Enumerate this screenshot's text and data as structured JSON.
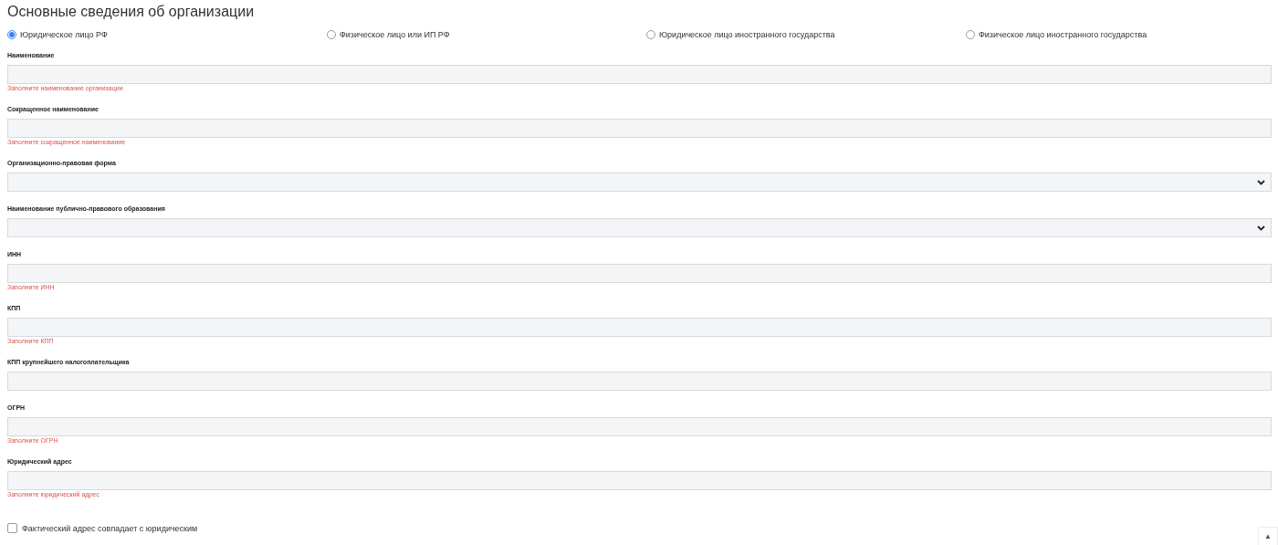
{
  "title": "Основные сведения об организации",
  "entity_types": [
    {
      "label": "Юридическое лицо РФ",
      "selected": true
    },
    {
      "label": "Физическое лицо или ИП РФ",
      "selected": false
    },
    {
      "label": "Юридическое лицо иностранного государства",
      "selected": false
    },
    {
      "label": "Физическое лицо иностранного государства",
      "selected": false
    }
  ],
  "fields": [
    {
      "kind": "text",
      "label": "Наименование",
      "error": "Заполните наименование организации"
    },
    {
      "kind": "text",
      "label": "Сокращенное наименование",
      "error": "Заполните сокращенное наименование"
    },
    {
      "kind": "select",
      "label": "Организационно-правовая форма"
    },
    {
      "kind": "select",
      "label": "Наименование публично-правового образования"
    },
    {
      "kind": "text",
      "label": "ИНН",
      "error": "Заполните ИНН"
    },
    {
      "kind": "text",
      "label": "КПП",
      "error": "Заполните КПП"
    },
    {
      "kind": "text",
      "label": "КПП крупнейшего налогоплательщика"
    },
    {
      "kind": "text",
      "label": "ОГРН",
      "error": "Заполните ОГРН"
    },
    {
      "kind": "text",
      "label": "Юридический адрес",
      "error": "Заполните юридический адрес"
    }
  ],
  "same_address": {
    "label": "Фактический адрес совпадает с юридическим",
    "checked": false
  },
  "scroll_top_button": "▲"
}
